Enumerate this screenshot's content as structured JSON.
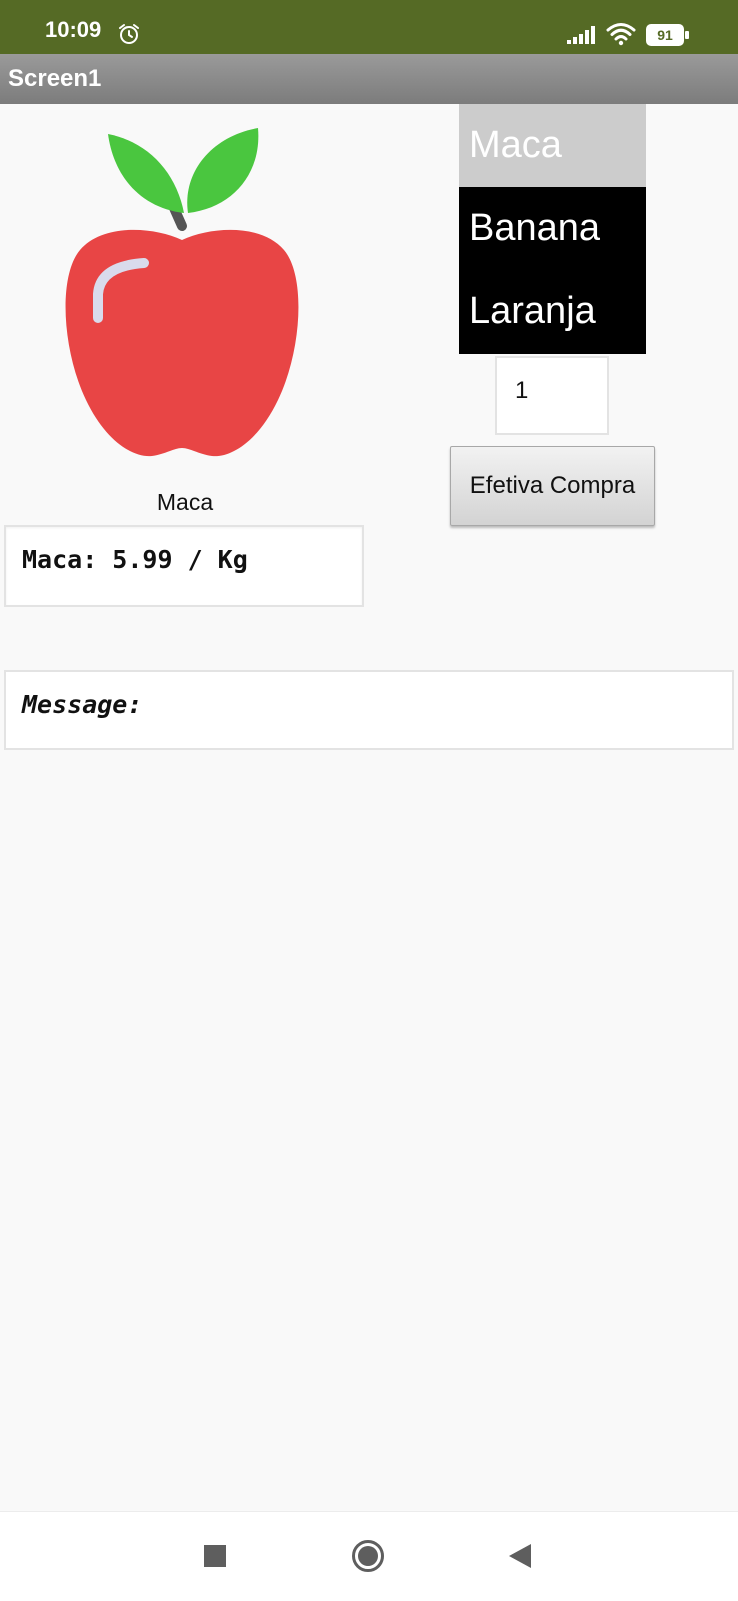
{
  "status_bar": {
    "time": "10:09",
    "battery_level": "91",
    "icons": [
      "alarm-icon",
      "signal-icon",
      "wifi-icon",
      "battery-icon"
    ]
  },
  "app_bar": {
    "title": "Screen1"
  },
  "product": {
    "image_icon": "apple-icon",
    "name_label": "Maca",
    "price_text": "Maca: 5.99 / Kg"
  },
  "fruit_list": {
    "items": [
      "Maca",
      "Banana",
      "Laranja"
    ],
    "selected": "Maca"
  },
  "quantity": {
    "value": "1"
  },
  "buy_button": {
    "label": "Efetiva Compra"
  },
  "message": {
    "text": "Message:"
  },
  "nav_bar": {
    "icons": [
      "recent-apps-icon",
      "home-icon",
      "back-icon"
    ]
  },
  "colors": {
    "status_bar": "#556a25",
    "app_bar": "#8a8a8a",
    "apple_red": "#e84545",
    "leaf_green": "#4ac63f",
    "list_bg": "#000000",
    "list_selected": "#cccccc"
  }
}
